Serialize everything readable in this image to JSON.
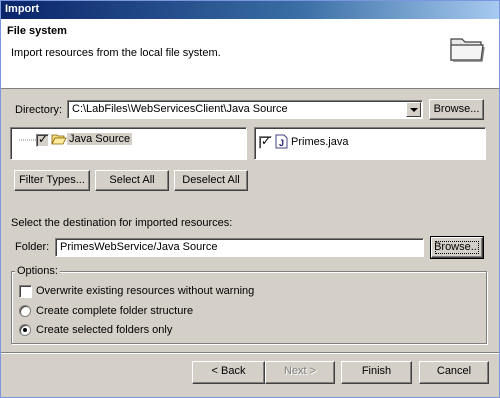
{
  "window": {
    "title": "Import"
  },
  "banner": {
    "title": "File system",
    "description": "Import resources from the local file system.",
    "icon": "folder-icon"
  },
  "directory": {
    "label": "Directory:",
    "value": "C:\\LabFiles\\WebServicesClient\\Java Source",
    "browse_label": "Browse..."
  },
  "tree": {
    "items": [
      {
        "label": "Java Source",
        "checked": "partial",
        "icon": "open-folder-icon"
      }
    ]
  },
  "files": {
    "items": [
      {
        "label": "Primes.java",
        "checked": true,
        "icon": "java-file-icon"
      }
    ]
  },
  "buttons": {
    "filter_types": "Filter Types...",
    "select_all": "Select All",
    "deselect_all": "Deselect All"
  },
  "destination": {
    "prompt": "Select the destination for imported resources:",
    "folder_label": "Folder:",
    "folder_value": "PrimesWebService/Java Source",
    "browse_label": "Browse..."
  },
  "options": {
    "title": "Options:",
    "overwrite_label": "Overwrite existing resources without warning",
    "overwrite_checked": false,
    "radios": [
      {
        "label": "Create complete folder structure",
        "selected": false
      },
      {
        "label": "Create selected folders only",
        "selected": true
      }
    ]
  },
  "footer": {
    "back": "< Back",
    "next": "Next >",
    "finish": "Finish",
    "cancel": "Cancel"
  },
  "colors": {
    "title_gradient_start": "#0a246a",
    "face": "#d4d0c8"
  }
}
